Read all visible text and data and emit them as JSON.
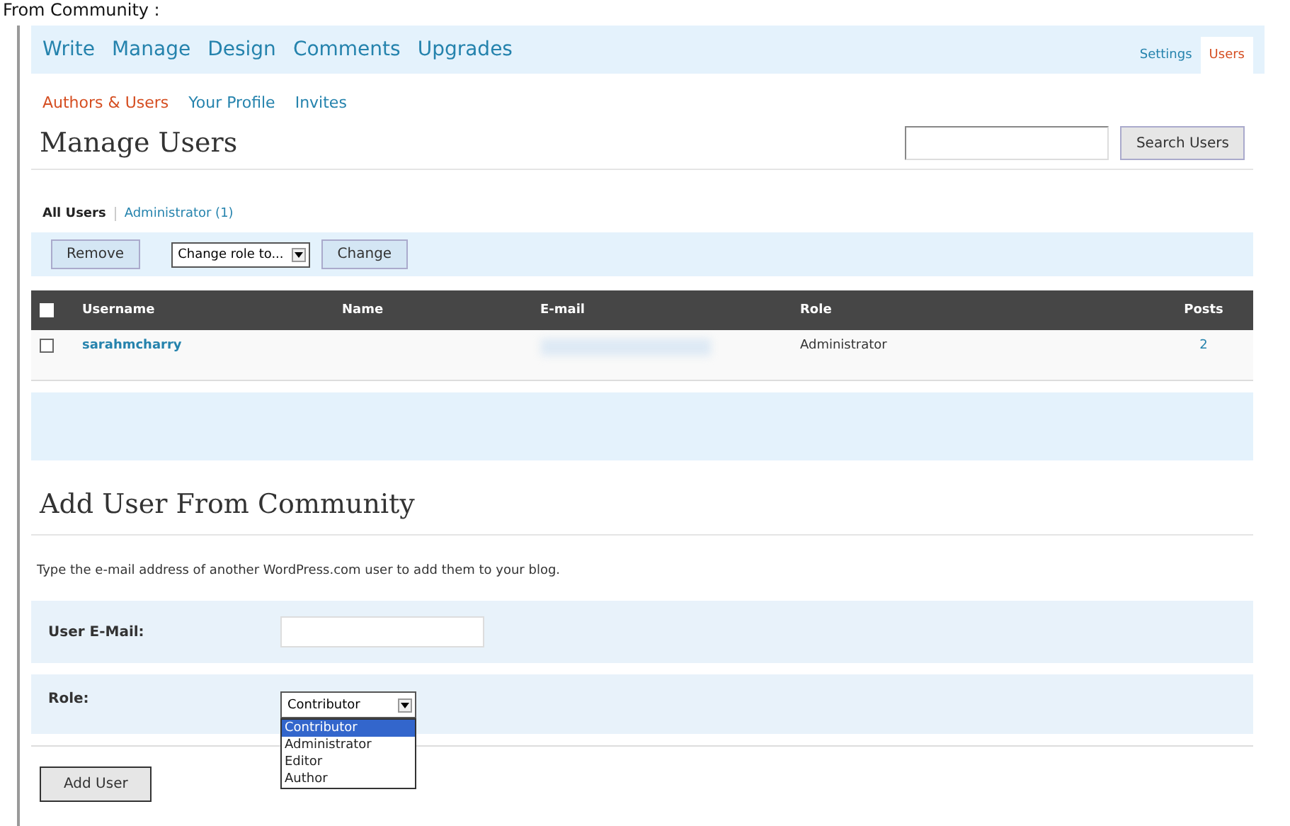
{
  "caption": "From Community :",
  "nav": {
    "items": [
      {
        "label": "Write",
        "selected": false
      },
      {
        "label": "Manage",
        "selected": false
      },
      {
        "label": "Design",
        "selected": false
      },
      {
        "label": "Comments",
        "selected": false
      },
      {
        "label": "Upgrades",
        "selected": false
      }
    ],
    "right_tabs": [
      {
        "label": "Settings",
        "selected": false
      },
      {
        "label": "Users",
        "selected": true
      }
    ]
  },
  "subnav": [
    {
      "label": "Authors & Users",
      "selected": true
    },
    {
      "label": "Your Profile",
      "selected": false
    },
    {
      "label": "Invites",
      "selected": false
    }
  ],
  "manage_users": {
    "title": "Manage Users",
    "search_button": "Search Users",
    "filters": [
      {
        "label": "All Users",
        "selected": true
      },
      {
        "label": "Administrator (1)",
        "selected": false
      }
    ],
    "actions": {
      "remove": "Remove",
      "role_select": "Change role to...",
      "change": "Change"
    },
    "table": {
      "select_all_checked": false,
      "columns": [
        "Username",
        "Name",
        "E-mail",
        "Role",
        "Posts"
      ],
      "rows": [
        {
          "checked": false,
          "username": "sarahmcharry",
          "role": "Administrator",
          "posts": "2"
        }
      ]
    }
  },
  "add_user": {
    "title": "Add User From Community",
    "instructions": "Type the e-mail address of another WordPress.com user to add them to your blog.",
    "email_label": "User E-Mail:",
    "role_label": "Role:",
    "role_value": "Contributor",
    "role_options": [
      {
        "label": "Contributor",
        "selected": true
      },
      {
        "label": "Administrator",
        "selected": false
      },
      {
        "label": "Editor",
        "selected": false
      },
      {
        "label": "Author",
        "selected": false
      }
    ],
    "submit": "Add User"
  }
}
